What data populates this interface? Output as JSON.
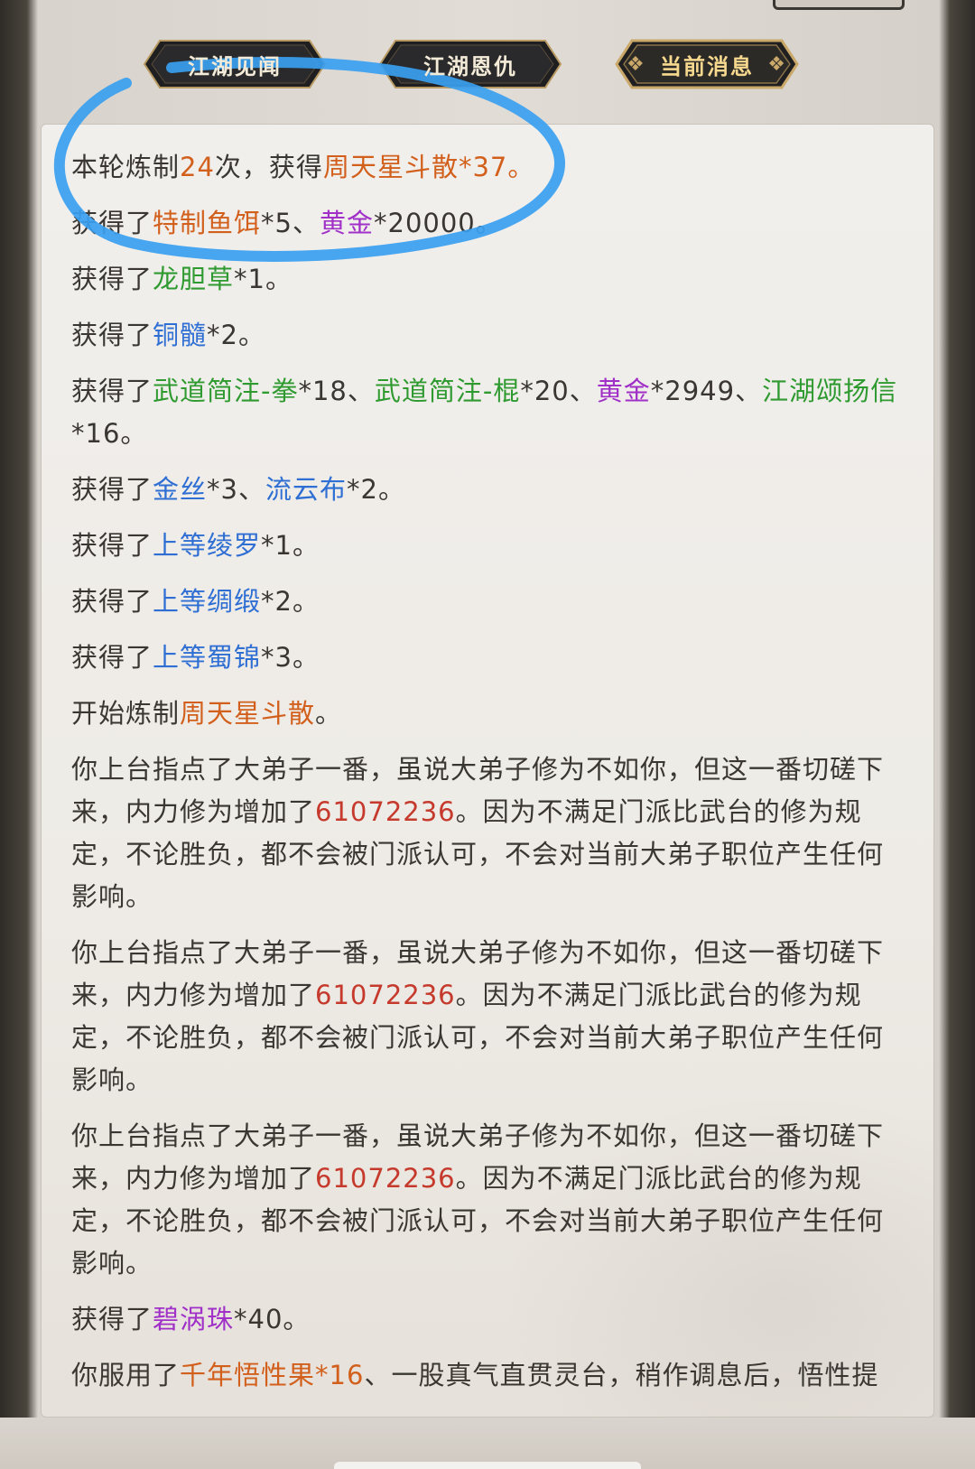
{
  "tabs": [
    {
      "label": "江湖见闻"
    },
    {
      "label": "江湖恩仇"
    },
    {
      "label": "当前消息"
    }
  ],
  "log": {
    "e1": {
      "a": "本轮炼制",
      "b": "24",
      "c": "次，获得",
      "d": "周天星斗散",
      "e": "*37。"
    },
    "e2": {
      "a": "获得了",
      "b": "特制鱼饵",
      "c": "*5、",
      "d": "黄金",
      "e": "*20000。"
    },
    "e3": {
      "a": "获得了",
      "b": "龙胆草",
      "c": "*1。"
    },
    "e4": {
      "a": "获得了",
      "b": "铜髓",
      "c": "*2。"
    },
    "e5": {
      "a": "获得了",
      "b": "武道简注-拳",
      "c": "*18、",
      "d": "武道简注-棍",
      "e": "*20、",
      "f": "黄金",
      "g": "*2949、",
      "h": "江湖颂扬信",
      "i": "*16。"
    },
    "e6": {
      "a": "获得了",
      "b": "金丝",
      "c": "*3、",
      "d": "流云布",
      "e": "*2。"
    },
    "e7": {
      "a": "获得了",
      "b": "上等绫罗",
      "c": "*1。"
    },
    "e8": {
      "a": "获得了",
      "b": "上等绸缎",
      "c": "*2。"
    },
    "e9": {
      "a": "获得了",
      "b": "上等蜀锦",
      "c": "*3。"
    },
    "e10": {
      "a": "开始炼制",
      "b": "周天星斗散",
      "c": "。"
    },
    "spar": {
      "a": "你上台指点了大弟子一番，虽说大弟子修为不如你，但这一番切磋下来，内力修为增加了",
      "b": "61072236",
      "c": "。因为不满足门派比武台的修为规定，不论胜负，都不会被门派认可，不会对当前大弟子职位产生任何影响。"
    },
    "e14": {
      "a": "获得了",
      "b": "碧涡珠",
      "c": "*40。"
    },
    "e15": {
      "a": "你服用了",
      "b": "千年悟性果",
      "c": "*16",
      "d": "、一股真气直贯灵台，稍作调息后，悟性提"
    }
  },
  "colors": {
    "orange": "#d2601c",
    "purple": "#a030c8",
    "green": "#2e9a30",
    "blue": "#2f6fd3",
    "red": "#c53a2c",
    "annotation": "#3aa0f0"
  }
}
